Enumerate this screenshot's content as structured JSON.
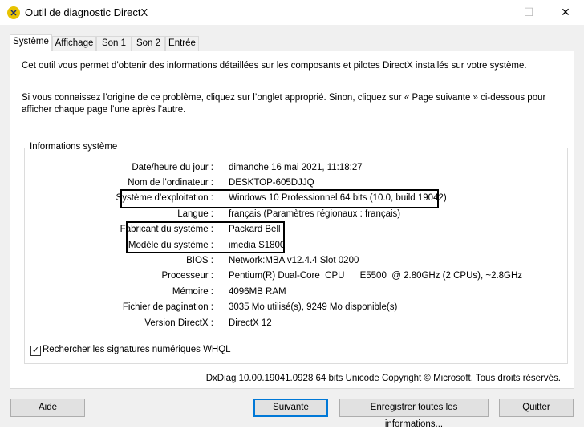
{
  "window": {
    "title": "Outil de diagnostic DirectX",
    "icon": "directx-icon",
    "controls": {
      "minimize": "—",
      "maximize": "☐",
      "close": "✕"
    }
  },
  "tabs": [
    "Système",
    "Affichage",
    "Son 1",
    "Son 2",
    "Entrée"
  ],
  "active_tab": "Système",
  "intro": {
    "line1": "Cet outil vous permet d’obtenir des informations détaillées sur les composants et pilotes DirectX installés sur votre système.",
    "line2": "Si vous connaissez l’origine de ce problème, cliquez sur l’onglet approprié. Sinon, cliquez sur « Page suivante » ci-dessous pour afficher chaque page l’une après l’autre."
  },
  "system_info": {
    "group_title": "Informations système",
    "rows": [
      {
        "label": "Date/heure du jour :",
        "value": "dimanche 16 mai 2021, 11:18:27"
      },
      {
        "label": "Nom de l’ordinateur :",
        "value": "DESKTOP-605DJJQ"
      },
      {
        "label": "Système d’exploitation :",
        "value": "Windows 10 Professionnel 64 bits (10.0, build 19042)"
      },
      {
        "label": "Langue :",
        "value": "français (Paramètres régionaux : français)"
      },
      {
        "label": "Fabricant du système :",
        "value": "Packard Bell"
      },
      {
        "label": "Modèle du système :",
        "value": "imedia S1800"
      },
      {
        "label": "BIOS :",
        "value": "Network:MBA v12.4.4 Slot 0200"
      },
      {
        "label": "Processeur :",
        "value": "Pentium(R) Dual-Core  CPU      E5500  @ 2.80GHz (2 CPUs), ~2.8GHz"
      },
      {
        "label": "Mémoire :",
        "value": "4096MB RAM"
      },
      {
        "label": "Fichier de pagination :",
        "value": "3035 Mo utilisé(s), 9249 Mo disponible(s)"
      },
      {
        "label": "Version DirectX :",
        "value": "DirectX 12"
      }
    ]
  },
  "whql_checkbox": {
    "label": "Rechercher les signatures numériques WHQL",
    "checked": true
  },
  "footer": "DxDiag 10.00.19041.0928 64 bits Unicode Copyright © Microsoft. Tous droits réservés.",
  "buttons": {
    "help": "Aide",
    "next": "Suivante",
    "save_all": "Enregistrer toutes les informations...",
    "quit": "Quitter"
  }
}
